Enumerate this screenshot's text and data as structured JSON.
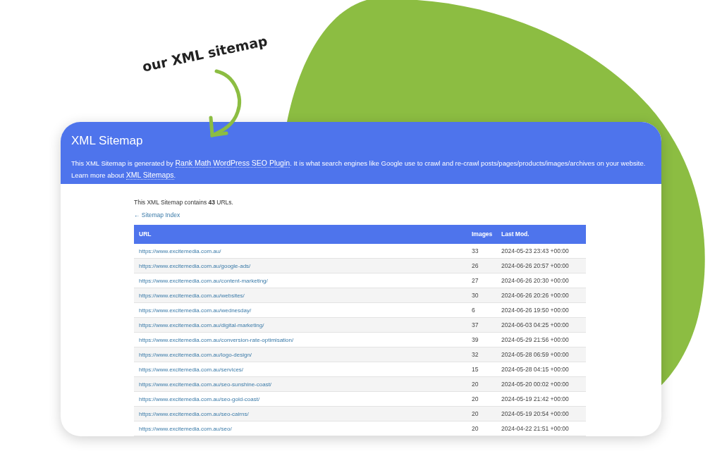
{
  "annotation": {
    "text": "our XML sitemap"
  },
  "header": {
    "title": "XML Sitemap",
    "description_lines": [
      [
        {
          "kind": "text",
          "text": "This XML Sitemap is generated by "
        },
        {
          "kind": "link",
          "text": "Rank Math WordPress SEO Plugin"
        },
        {
          "kind": "text",
          "text": ". It is what search engines like Google use to crawl and re-crawl posts/pages/products/images/archives on your website."
        }
      ],
      [
        {
          "kind": "text",
          "text": "Learn more about "
        },
        {
          "kind": "link",
          "text": "XML Sitemaps"
        },
        {
          "kind": "text",
          "text": "."
        }
      ]
    ]
  },
  "summary": "This XML Sitemap contains **43** URLs.",
  "back_link": "← Sitemap Index",
  "table": {
    "columns": [
      "URL",
      "Images",
      "Last Mod."
    ],
    "rows": [
      [
        "https://www.excitemedia.com.au/",
        "33",
        "2024-05-23 23:43 +00:00"
      ],
      [
        "https://www.excitemedia.com.au/google-ads/",
        "26",
        "2024-06-26 20:57 +00:00"
      ],
      [
        "https://www.excitemedia.com.au/content-marketing/",
        "27",
        "2024-06-26 20:30 +00:00"
      ],
      [
        "https://www.excitemedia.com.au/websites/",
        "30",
        "2024-06-26 20:26 +00:00"
      ],
      [
        "https://www.excitemedia.com.au/wednesday/",
        "6",
        "2024-06-26 19:50 +00:00"
      ],
      [
        "https://www.excitemedia.com.au/digital-marketing/",
        "37",
        "2024-06-03 04:25 +00:00"
      ],
      [
        "https://www.excitemedia.com.au/conversion-rate-optimisation/",
        "39",
        "2024-05-29 21:56 +00:00"
      ],
      [
        "https://www.excitemedia.com.au/logo-design/",
        "32",
        "2024-05-28 06:59 +00:00"
      ],
      [
        "https://www.excitemedia.com.au/services/",
        "15",
        "2024-05-28 04:15 +00:00"
      ],
      [
        "https://www.excitemedia.com.au/seo-sunshine-coast/",
        "20",
        "2024-05-20 00:02 +00:00"
      ],
      [
        "https://www.excitemedia.com.au/seo-gold-coast/",
        "20",
        "2024-05-19 21:42 +00:00"
      ],
      [
        "https://www.excitemedia.com.au/seo-cairns/",
        "20",
        "2024-05-19 20:54 +00:00"
      ],
      [
        "https://www.excitemedia.com.au/seo/",
        "20",
        "2024-04-22 21:51 +00:00"
      ]
    ]
  }
}
